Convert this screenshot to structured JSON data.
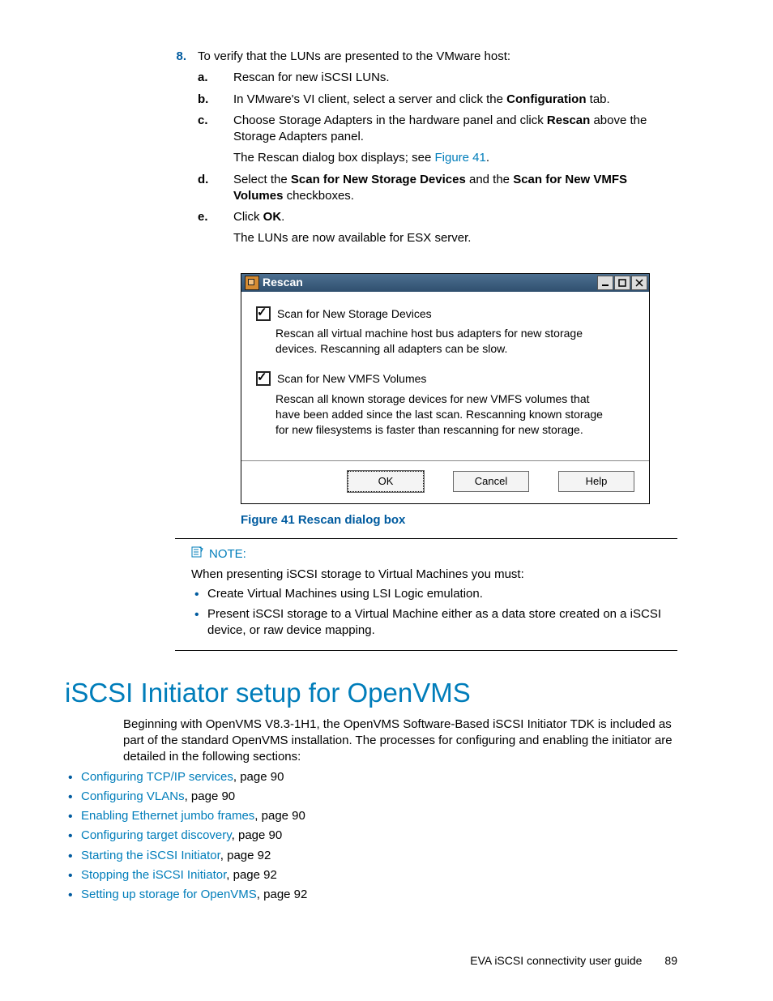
{
  "step8": {
    "number": "8.",
    "text": "To verify that the LUNs are presented to the VMware host:",
    "a": {
      "m": "a.",
      "t": "Rescan for new iSCSI LUNs."
    },
    "b": {
      "m": "b.",
      "pre": "In VMware's VI client, select a server and click the ",
      "bold": "Configuration",
      "post": " tab."
    },
    "c": {
      "m": "c.",
      "pre": "Choose Storage Adapters in the hardware panel and click ",
      "bold": "Rescan",
      "post": " above the Storage Adapters panel.",
      "p2a": "The Rescan dialog box displays; see ",
      "p2link": "Figure 41",
      "p2b": "."
    },
    "d": {
      "m": "d.",
      "pre": "Select the ",
      "b1": "Scan for New Storage Devices",
      "mid": " and the ",
      "b2": "Scan for New VMFS Volumes",
      "post": " checkboxes."
    },
    "e": {
      "m": "e.",
      "pre": "Click ",
      "bold": "OK",
      "post": ".",
      "p2": "The LUNs are now available for ESX server."
    }
  },
  "dialog": {
    "title": "Rescan",
    "chk1": "Scan for New Storage Devices",
    "desc1": "Rescan all virtual machine host bus adapters for new storage devices.  Rescanning all adapters can be slow.",
    "chk2": "Scan for New VMFS Volumes",
    "desc2": "Rescan all known storage devices for new VMFS volumes that have been added since the last scan. Rescanning known storage for new filesystems is faster than rescanning for new storage.",
    "ok": "OK",
    "cancel": "Cancel",
    "help": "Help"
  },
  "caption": "Figure 41 Rescan dialog box",
  "note": {
    "head": "NOTE:",
    "lead": "When presenting iSCSI storage to Virtual Machines you must:",
    "b1": "Create Virtual Machines using LSI Logic emulation.",
    "b2": "Present iSCSI storage to a Virtual Machine either as a data store created on a iSCSI device, or raw device mapping."
  },
  "h1": "iSCSI Initiator setup for OpenVMS",
  "intro": "Beginning with OpenVMS V8.3-1H1, the OpenVMS Software-Based iSCSI Initiator TDK is included as part of the standard OpenVMS installation.  The processes for configuring and enabling the initiator are detailed in the following sections:",
  "toc": [
    {
      "link": "Configuring TCP/IP services",
      "rest": ", page 90"
    },
    {
      "link": "Configuring VLANs",
      "rest": ", page 90"
    },
    {
      "link": "Enabling Ethernet jumbo frames",
      "rest": ", page 90"
    },
    {
      "link": "Configuring target discovery",
      "rest": ", page 90"
    },
    {
      "link": "Starting the iSCSI Initiator",
      "rest": ", page 92"
    },
    {
      "link": "Stopping the iSCSI Initiator",
      "rest": ", page 92"
    },
    {
      "link": "Setting up storage for OpenVMS",
      "rest": ", page 92"
    }
  ],
  "footer": {
    "title": "EVA iSCSI connectivity user guide",
    "page": "89"
  }
}
